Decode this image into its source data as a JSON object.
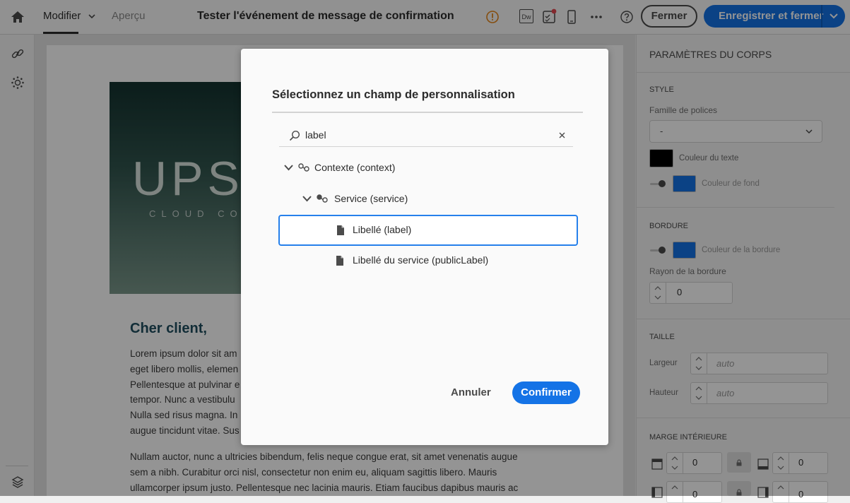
{
  "topbar": {
    "tab_edit": "Modifier",
    "tab_preview": "Aperçu",
    "title": "Tester l'événement de message de confirmation",
    "dw_label": "Dw",
    "close_label": "Fermer",
    "save_label": "Enregistrer et fermer"
  },
  "email": {
    "hero_big": "UPSTA",
    "hero_small": "CLOUD CON",
    "greeting": "Cher client,",
    "p1": [
      "Lorem ipsum dolor sit am",
      "eget libero mollis, elemen",
      "Pellentesque at pulvinar e",
      "tempor. Nunc a vestibulu",
      "Nulla sed risus magna. In",
      "augue tincidunt vitae. Sus"
    ],
    "p2": [
      "Nullam auctor, nunc a ultricies bibendum, felis neque congue erat, sit amet venenatis augue",
      "sem a nibh. Curabitur orci nisl, consectetur non enim eu, aliquam sagittis libero. Mauris",
      "ullamcorper ipsum justo. Pellentesque nec lacinia mauris. Etiam faucibus dapibus mauris ac"
    ]
  },
  "panel": {
    "title": "PARAMÈTRES DU CORPS",
    "style_section": "STYLE",
    "font_family_label": "Famille de polices",
    "font_family_value": "-",
    "text_color_label": "Couleur du texte",
    "bg_color_label": "Couleur de fond",
    "border_section": "BORDURE",
    "border_color_label": "Couleur de la bordure",
    "border_radius_label": "Rayon de la bordure",
    "border_radius_value": "0",
    "size_section": "TAILLE",
    "width_label": "Largeur",
    "width_placeholder": "auto",
    "height_label": "Hauteur",
    "height_placeholder": "auto",
    "padding_section": "MARGE INTÉRIEURE",
    "padding_top": "0",
    "padding_bottom": "0",
    "padding_left": "0",
    "padding_right": "0",
    "colors": {
      "text": "#000000",
      "background": "#1473e6",
      "border": "#1473e6"
    }
  },
  "dialog": {
    "title": "Sélectionnez un champ de personnalisation",
    "search_value": "label",
    "tree": [
      {
        "label": "Contexte (context)"
      },
      {
        "label": "Service (service)"
      },
      {
        "label": "Libellé (label)"
      },
      {
        "label": "Libellé du service (publicLabel)"
      }
    ],
    "cancel_label": "Annuler",
    "confirm_label": "Confirmer"
  },
  "colors": {
    "accent": "#1473e6",
    "selection": "#2680eb",
    "warning": "#e68619"
  }
}
